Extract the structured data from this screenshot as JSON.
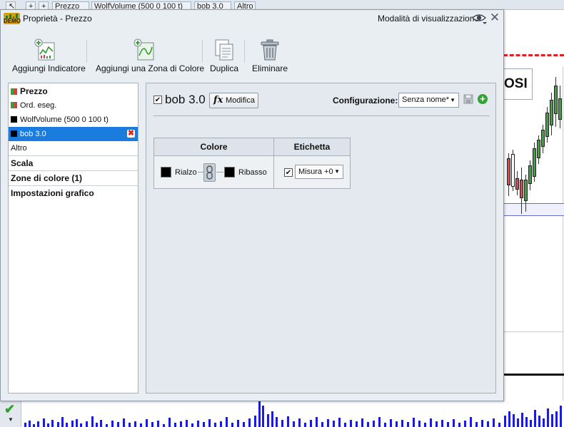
{
  "background": {
    "tabs": [
      "Prezzo",
      "WolfVolume (500 0 100 t)",
      "bob 3.0",
      "Altro"
    ],
    "chart_label": "OSI"
  },
  "dialog": {
    "title": "Proprietà - Prezzo",
    "demo_badge": "DEMO",
    "view_mode_label": "Modalità di visualizzazione",
    "toolbar": {
      "add_indicator": "Aggiungi Indicatore",
      "add_color_zone": "Aggiungi una Zona di Colore",
      "duplicate": "Duplica",
      "delete": "Eliminare"
    },
    "list": {
      "items": [
        {
          "label": "Prezzo",
          "swatch": "split"
        },
        {
          "label": "Ord. eseg.",
          "swatch": "split"
        },
        {
          "label": "WolfVolume (500 0 100 t)",
          "swatch": "black"
        },
        {
          "label": "bob 3.0",
          "swatch": "black",
          "selected": true
        },
        {
          "label": "Altro"
        }
      ],
      "sections": [
        "Scala",
        "Zone di colore (1)",
        "Impostazioni grafico"
      ]
    },
    "indicator": {
      "name": "bob 3.0",
      "enabled": true,
      "modify_label": "Modifica",
      "fx_symbol": "fx"
    },
    "configuration": {
      "label": "Configurazione:",
      "selected": "Senza nome*"
    },
    "color_table": {
      "col_color": "Colore",
      "col_label": "Etichetta",
      "up_label": "Rialzo",
      "down_label": "Ribasso",
      "up_color": "#000000",
      "down_color": "#000000",
      "label_enabled": true,
      "label_value": "Misura +0"
    }
  }
}
